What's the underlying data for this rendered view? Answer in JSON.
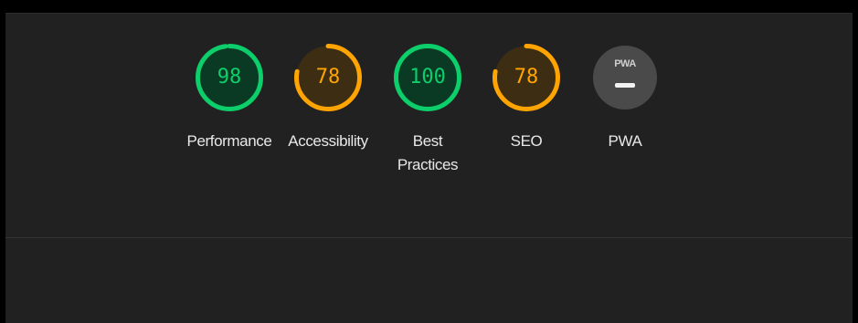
{
  "categories": [
    {
      "id": "performance",
      "score": "98",
      "fraction": 0.98,
      "label": "Performance",
      "status": "pass"
    },
    {
      "id": "accessibility",
      "score": "78",
      "fraction": 0.78,
      "label": "Accessibility",
      "status": "average"
    },
    {
      "id": "best-practices",
      "score": "100",
      "fraction": 1.0,
      "label": "Best Practices",
      "status": "pass"
    },
    {
      "id": "seo",
      "score": "78",
      "fraction": 0.78,
      "label": "SEO",
      "status": "average"
    }
  ],
  "pwa": {
    "badge_text": "PWA",
    "label": "PWA"
  },
  "colors": {
    "pass": "#0cce6b",
    "pass_bg": "#0a3a24",
    "average": "#ffa400",
    "average_bg": "#3d2e13",
    "background": "#212121"
  }
}
